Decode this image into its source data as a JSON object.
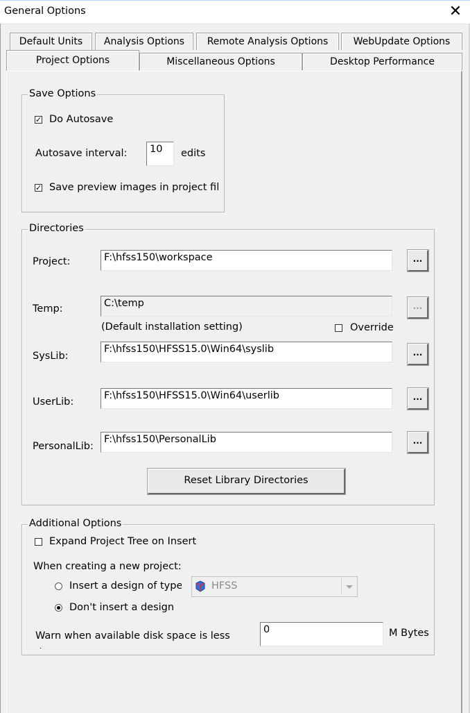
{
  "window": {
    "title": "General Options",
    "close_glyph": "✕"
  },
  "tabs": {
    "row1": [
      "Default Units",
      "Analysis Options",
      "Remote Analysis Options",
      "WebUpdate Options"
    ],
    "row2": [
      "Project Options",
      "Miscellaneous Options",
      "Desktop Performance"
    ],
    "active": "Project Options"
  },
  "save_options": {
    "legend": "Save Options",
    "do_autosave": {
      "label": "Do Autosave",
      "checked": true
    },
    "autosave_interval": {
      "label": "Autosave interval:",
      "value": "10",
      "unit": "edits"
    },
    "save_preview": {
      "label": "Save preview images in project fil",
      "checked": true
    }
  },
  "directories": {
    "legend": "Directories",
    "project": {
      "label": "Project:",
      "value": "F:\\hfss150\\workspace"
    },
    "temp": {
      "label": "Temp:",
      "value": "C:\\temp",
      "note": "(Default installation setting)",
      "override_label": "Override",
      "override_checked": false
    },
    "syslib": {
      "label": "SysLib:",
      "value": "F:\\hfss150\\HFSS15.0\\Win64\\syslib"
    },
    "userlib": {
      "label": "UserLib:",
      "value": "F:\\hfss150\\HFSS15.0\\Win64\\userlib"
    },
    "personallib": {
      "label": "PersonalLib:",
      "value": "F:\\hfss150\\PersonalLib"
    },
    "browse_label": "...",
    "reset_button": "Reset Library Directories"
  },
  "additional_options": {
    "legend": "Additional Options",
    "expand_tree": {
      "label": "Expand Project Tree on Insert",
      "checked": false
    },
    "new_project_label": "When creating a new project:",
    "insert_design": {
      "label": "Insert a design of type",
      "selected": false
    },
    "design_type": "HFSS",
    "dont_insert": {
      "label": "Don't insert a design",
      "selected": true
    },
    "disk_warn": {
      "label": "Warn when available disk space is less than",
      "value": "0",
      "unit": "M Bytes"
    }
  }
}
